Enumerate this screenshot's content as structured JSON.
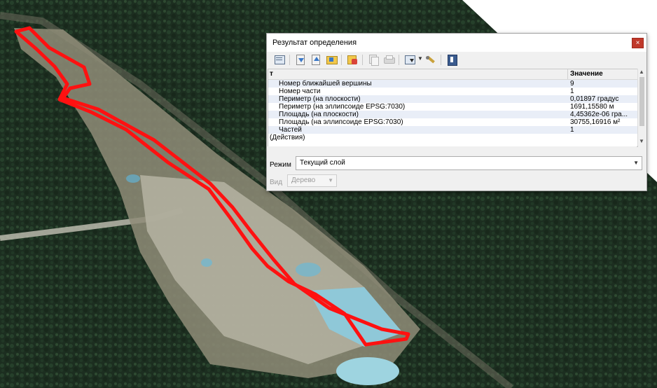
{
  "map": {
    "tree_color": "#1e3322",
    "quarry_color": "#a2a08a",
    "water_color": "#8fc8d8",
    "outline_color": "#ff1111"
  },
  "dialog": {
    "title": "Результат определения",
    "close_icon": "close-icon",
    "toolbar": [
      "expand-tree-icon",
      "expand-all-icon",
      "collapse-all-icon",
      "expand-new-icon",
      "clear-results-icon",
      "copy-icon",
      "print-icon",
      "select-mode-icon",
      "settings-icon",
      "help-icon"
    ],
    "columns": {
      "feature": "т",
      "value": "Значение"
    },
    "rows": [
      {
        "label": "Номер ближайшей вершины",
        "value": "9"
      },
      {
        "label": "Номер части",
        "value": "1"
      },
      {
        "label": "Периметр (на плоскости)",
        "value": "0,01897 градус"
      },
      {
        "label": "Периметр (на эллипсоиде EPSG:7030)",
        "value": "1691,15580 м"
      },
      {
        "label": "Площадь (на плоскости)",
        "value": "4,45362e-06 гра..."
      },
      {
        "label": "Площадь (на эллипсоиде EPSG:7030)",
        "value": "30755,16916 м²"
      },
      {
        "label": "Частей",
        "value": "1"
      },
      {
        "label": "(Действия)",
        "value": ""
      }
    ],
    "mode_label": "Режим",
    "mode_value": "Текущий слой",
    "view_label": "Вид",
    "view_value": "Дерево"
  }
}
